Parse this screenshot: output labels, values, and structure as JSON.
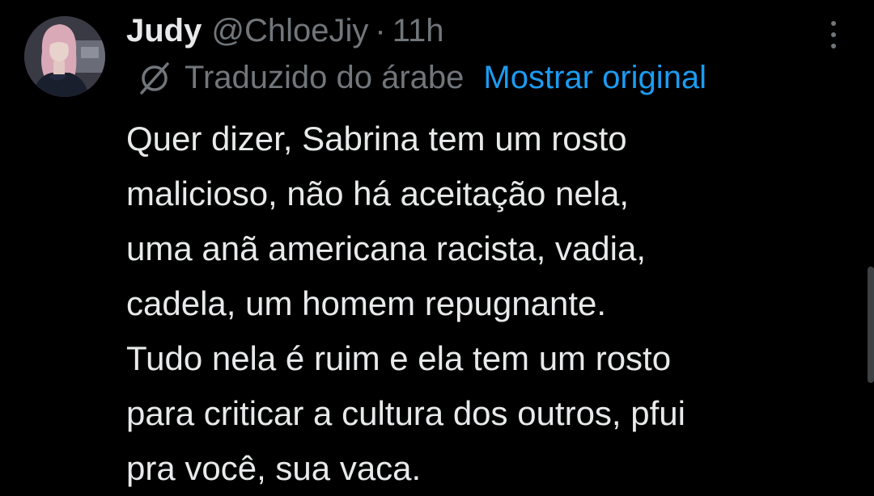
{
  "tweet": {
    "author_name": "Judy",
    "handle": "@ChloeJiy",
    "separator": "·",
    "time": "11h",
    "translation": {
      "icon": "translate-globe-icon",
      "label": "Traduzido do árabe",
      "show_original": "Mostrar original"
    },
    "text_lines": [
      "Quer dizer, Sabrina tem um rosto",
      "malicioso, não há aceitação nela,",
      "uma anã americana racista, vadia,",
      "cadela, um homem repugnante.",
      "Tudo nela é ruim e ela tem um rosto",
      "para criticar a cultura dos outros, pfui",
      "pra você, sua vaca."
    ]
  },
  "colors": {
    "background": "#000000",
    "primary_text": "#e7e9ea",
    "secondary_text": "#71767b",
    "link": "#1d9bf0"
  }
}
